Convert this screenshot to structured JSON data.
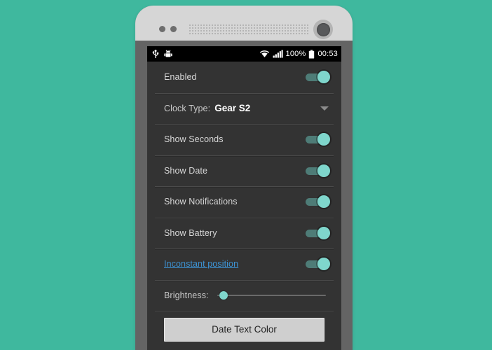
{
  "theme": {
    "background_color": "#3fb89e",
    "screen_background": "#333333",
    "accent_color": "#7fd6cc",
    "link_color": "#3d93d4",
    "phone_body_color": "#646464",
    "phone_bezel_color": "#d6d6d6"
  },
  "status_bar": {
    "icons_left": [
      "usb-icon",
      "android-debug-icon"
    ],
    "icons_right": [
      "wifi-icon",
      "signal-icon",
      "battery-icon"
    ],
    "battery_percent": "100%",
    "time": "00:53"
  },
  "settings": {
    "rows": [
      {
        "type": "toggle",
        "label": "Enabled",
        "toggle_on": true
      },
      {
        "type": "dropdown",
        "label": "Clock Type:",
        "value": "Gear S2"
      },
      {
        "type": "toggle",
        "label": "Show Seconds",
        "toggle_on": true
      },
      {
        "type": "toggle",
        "label": "Show Date",
        "toggle_on": true
      },
      {
        "type": "toggle",
        "label": "Show Notifications",
        "toggle_on": true
      },
      {
        "type": "toggle",
        "label": "Show Battery",
        "toggle_on": true
      },
      {
        "type": "toggle_link",
        "label": "Inconstant position",
        "toggle_on": true
      },
      {
        "type": "slider",
        "label": "Brightness:",
        "value_percent": 2
      }
    ],
    "button": {
      "label": "Date Text Color"
    }
  }
}
